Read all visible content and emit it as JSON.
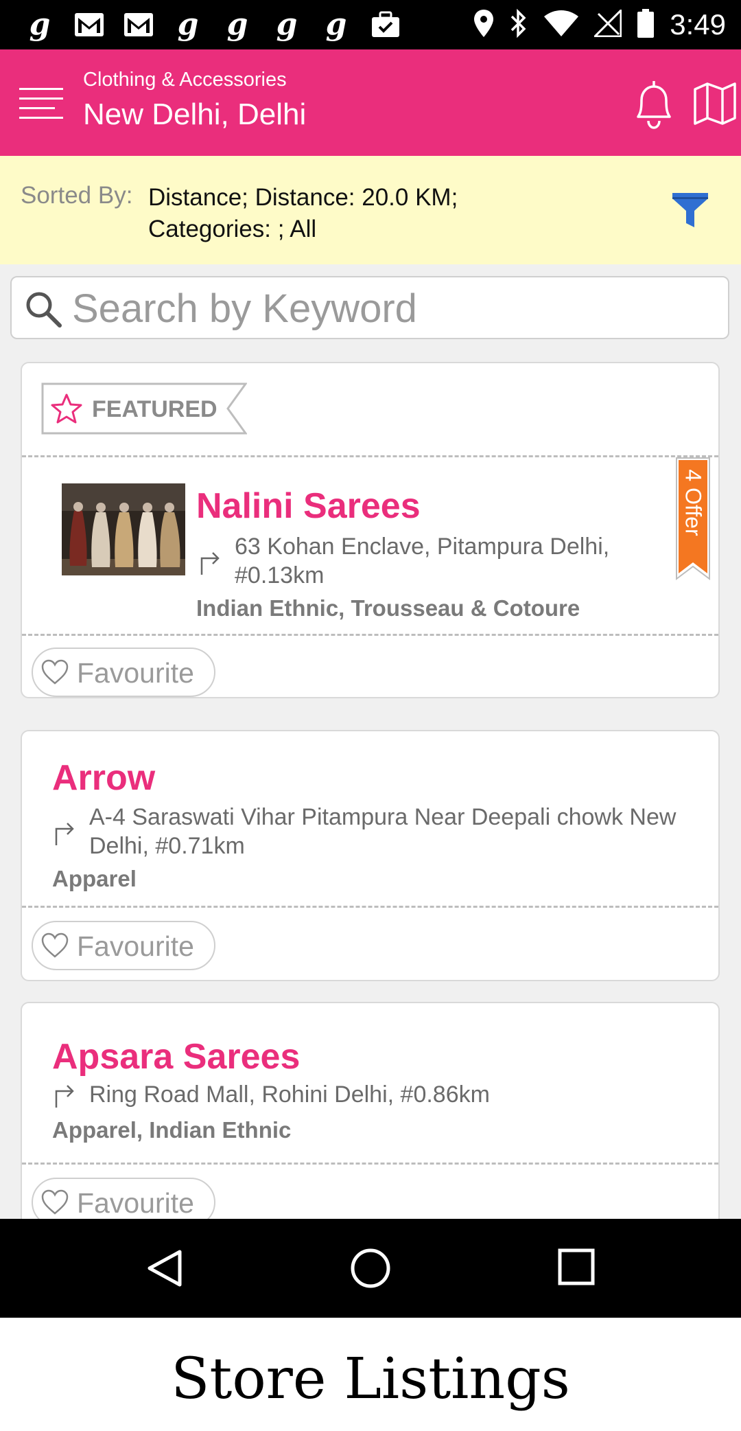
{
  "status_bar": {
    "time": "3:49",
    "notification_icons": [
      "g",
      "gmail-icon",
      "gmail-icon",
      "g",
      "g",
      "g",
      "g",
      "briefcase-icon"
    ],
    "g_glyph": "g"
  },
  "app_bar": {
    "category": "Clothing & Accessories",
    "location": "New Delhi, Delhi",
    "accent_color": "#EA2E7C"
  },
  "sort_bar": {
    "label": "Sorted By:",
    "value": "Distance; Distance: 20.0 KM; Categories: ; All"
  },
  "search": {
    "placeholder": "Search by Keyword",
    "value": ""
  },
  "listings": [
    {
      "featured_label": "FEATURED",
      "name": "Nalini Sarees",
      "address": "63 Kohan Enclave, Pitampura Delhi, #0.13km",
      "categories": "Indian Ethnic, Trousseau & Cotoure",
      "offer": "4 Offer",
      "favourite_label": "Favourite"
    },
    {
      "name": "Arrow",
      "address": "A-4 Saraswati Vihar Pitampura Near Deepali chowk New Delhi, #0.71km",
      "categories": "Apparel",
      "favourite_label": "Favourite"
    },
    {
      "name": "Apsara Sarees",
      "address": "Ring Road Mall, Rohini  Delhi, #0.86km",
      "categories": "Apparel, Indian Ethnic",
      "favourite_label": "Favourite"
    }
  ],
  "caption": "Store Listings"
}
